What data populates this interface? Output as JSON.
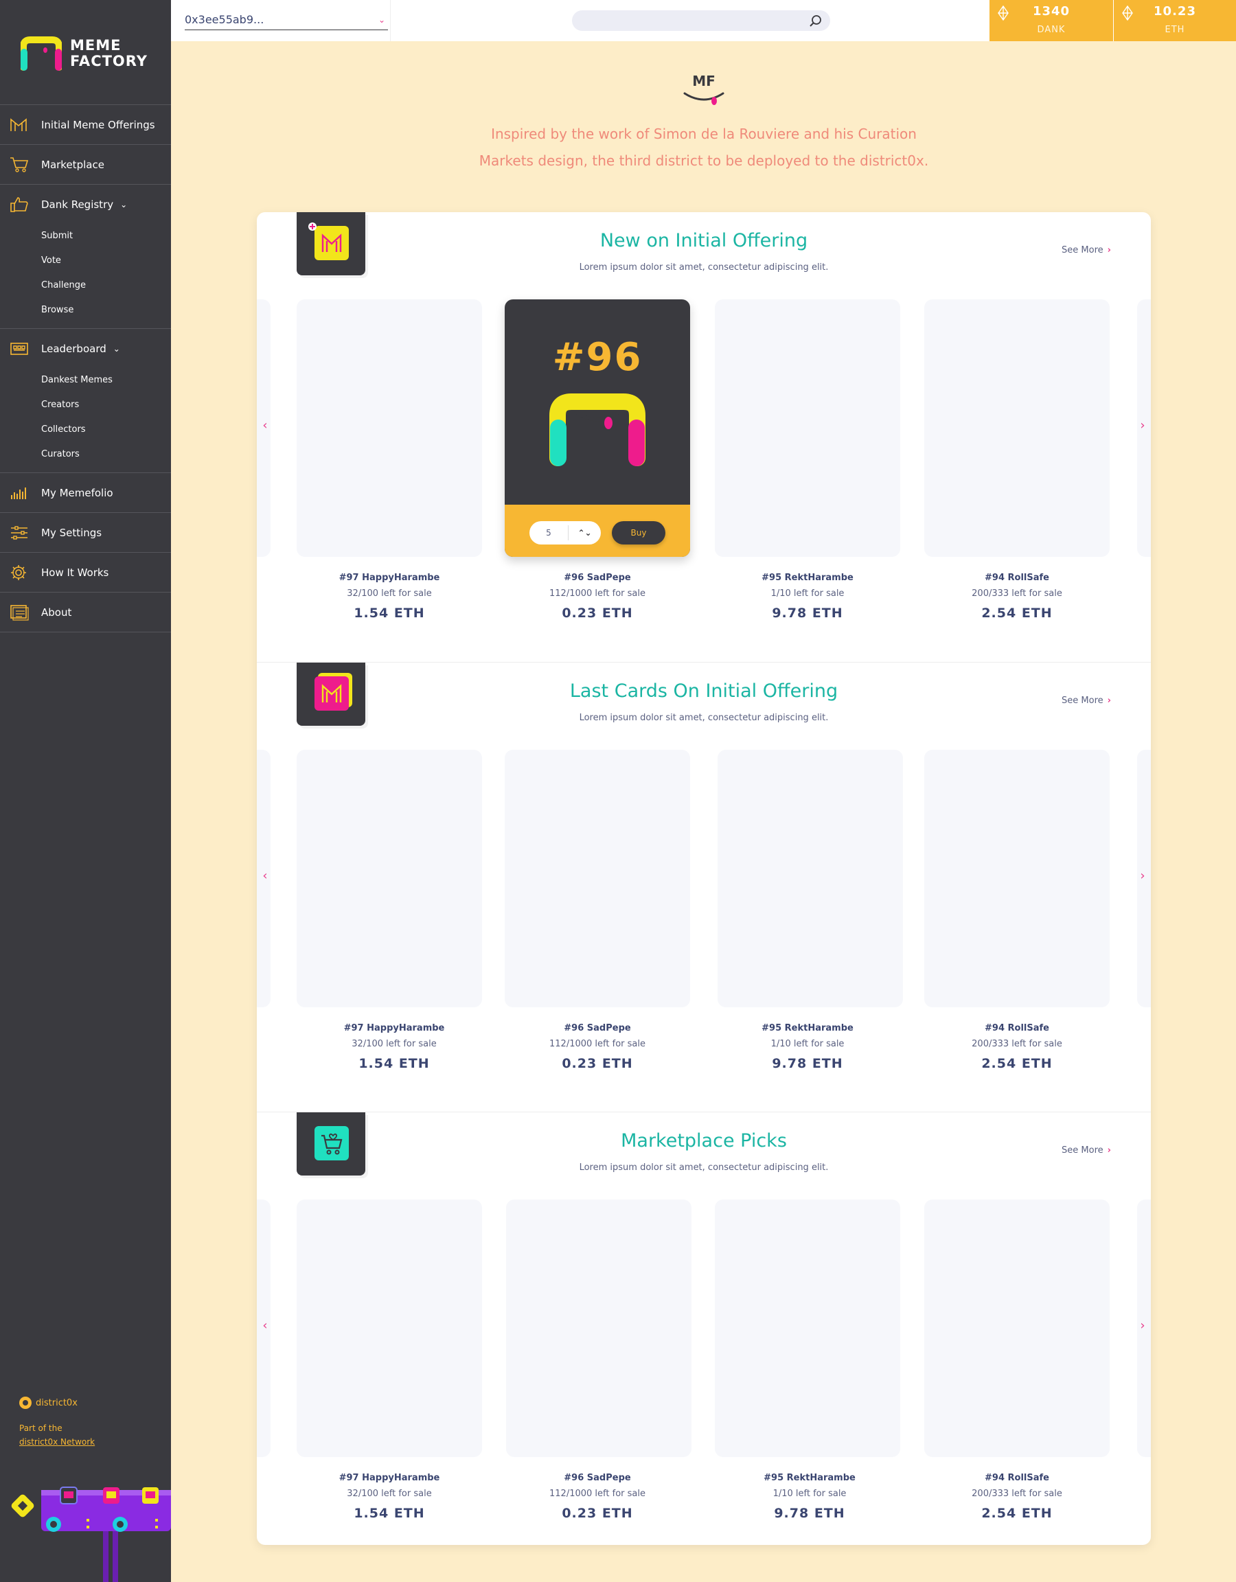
{
  "logo": {
    "line1": "MEME",
    "line2": "FACTORY"
  },
  "sidebar": {
    "items": [
      {
        "id": "initial-meme-offerings",
        "label": "Initial Meme Offerings",
        "icon": "meme-m-icon"
      },
      {
        "id": "marketplace",
        "label": "Marketplace",
        "icon": "cart-icon"
      },
      {
        "id": "dank-registry",
        "label": "Dank Registry",
        "icon": "thumbs-up-icon",
        "sub": [
          "Submit",
          "Vote",
          "Challenge",
          "Browse"
        ]
      },
      {
        "id": "leaderboard",
        "label": "Leaderboard",
        "icon": "leaderboard-icon",
        "sub": [
          "Dankest Memes",
          "Creators",
          "Collectors",
          "Curators"
        ]
      },
      {
        "id": "my-memefolio",
        "label": "My Memefolio",
        "icon": "bar-chart-icon"
      },
      {
        "id": "my-settings",
        "label": "My Settings",
        "icon": "sliders-icon"
      },
      {
        "id": "how-it-works",
        "label": "How It Works",
        "icon": "gear-icon"
      },
      {
        "id": "about",
        "label": "About",
        "icon": "document-icon"
      }
    ],
    "district": {
      "brand": "district0x",
      "part_of": "Part of the",
      "network_link": "district0x Network"
    }
  },
  "topbar": {
    "account": "0x3ee55ab9...",
    "search_placeholder": "",
    "balances": [
      {
        "amount": "1340",
        "currency": "DANK"
      },
      {
        "amount": "10.23",
        "currency": "ETH"
      }
    ]
  },
  "hero": {
    "logo_text": "MF",
    "line1": "Inspired by the work of Simon de la Rouviere and his Curation",
    "line2": "Markets design, the third district to be deployed to the district0x."
  },
  "colors": {
    "accent": "#f7b733",
    "teal": "#1bb5a3",
    "pink": "#e83e8c",
    "dark": "#3a3a3f",
    "background": "#fdedc8"
  },
  "sections": [
    {
      "title": "New on Initial Offering",
      "subtitle": "Lorem ipsum dolor sit amet, consectetur adipiscing elit.",
      "see_more": "See More",
      "badge_icon": "new-offering-icon",
      "featured": {
        "number": "#96",
        "quantity": "5",
        "buy_label": "Buy"
      },
      "cards": [
        {
          "name": "#97 HappyHarambe",
          "left": "32/100 left for sale",
          "price": "1.54 ETH"
        },
        {
          "name": "#96 SadPepe",
          "left": "112/1000 left for sale",
          "price": "0.23 ETH"
        },
        {
          "name": "#95 RektHarambe",
          "left": "1/10 left for sale",
          "price": "9.78 ETH"
        },
        {
          "name": "#94 RollSafe",
          "left": "200/333 left for sale",
          "price": "2.54 ETH"
        }
      ]
    },
    {
      "title": "Last Cards On Initial Offering",
      "subtitle": "Lorem ipsum dolor sit amet, consectetur adipiscing elit.",
      "see_more": "See More",
      "badge_icon": "last-cards-icon",
      "cards": [
        {
          "name": "#97 HappyHarambe",
          "left": "32/100 left for sale",
          "price": "1.54 ETH"
        },
        {
          "name": "#96 SadPepe",
          "left": "112/1000 left for sale",
          "price": "0.23 ETH"
        },
        {
          "name": "#95 RektHarambe",
          "left": "1/10 left for sale",
          "price": "9.78 ETH"
        },
        {
          "name": "#94 RollSafe",
          "left": "200/333 left for sale",
          "price": "2.54 ETH"
        }
      ]
    },
    {
      "title": "Marketplace Picks",
      "subtitle": "Lorem ipsum dolor sit amet, consectetur adipiscing elit.",
      "see_more": "See More",
      "badge_icon": "marketplace-cart-icon",
      "cards": [
        {
          "name": "#97 HappyHarambe",
          "left": "32/100 left for sale",
          "price": "1.54 ETH"
        },
        {
          "name": "#96 SadPepe",
          "left": "112/1000 left for sale",
          "price": "0.23 ETH"
        },
        {
          "name": "#95 RektHarambe",
          "left": "1/10 left for sale",
          "price": "9.78 ETH"
        },
        {
          "name": "#94 RollSafe",
          "left": "200/333 left for sale",
          "price": "2.54 ETH"
        }
      ]
    }
  ]
}
